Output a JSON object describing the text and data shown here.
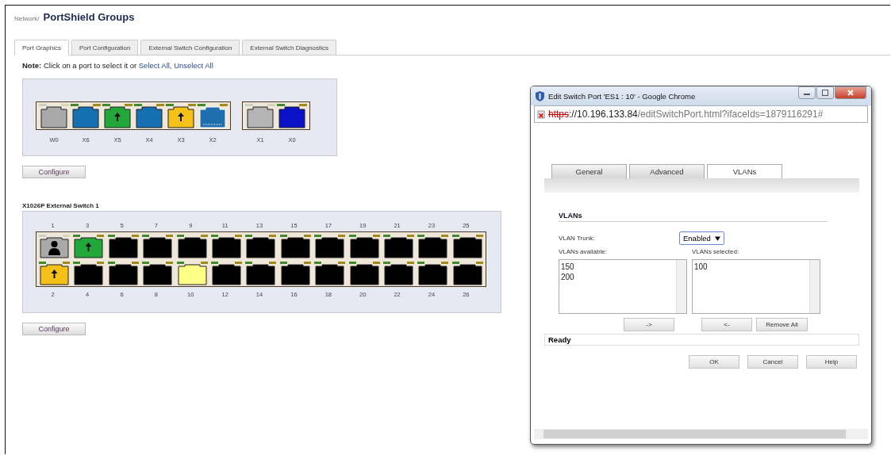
{
  "breadcrumb": {
    "parent": "Network",
    "separator": "/",
    "title": "PortShield Groups"
  },
  "tabs": [
    {
      "label": "Port Graphics",
      "selected": true
    },
    {
      "label": "Port Configuration",
      "selected": false
    },
    {
      "label": "External Switch Configuration",
      "selected": false
    },
    {
      "label": "External Switch Diagnostics",
      "selected": false
    }
  ],
  "note": {
    "text": "**Note:** Click on a port to select it or",
    "links": [
      "Select All",
      "Unselect All"
    ],
    "separator": ","
  },
  "builtin_switch": {
    "groups": [
      {
        "ports": [
          {
            "label": "W0",
            "color": "#a9a9a9",
            "kind": "plain"
          },
          {
            "label": "X6",
            "color": "#1470b0",
            "kind": "plain"
          },
          {
            "label": "X5",
            "color": "#22a83a",
            "kind": "arrow"
          },
          {
            "label": "X4",
            "color": "#1470b0",
            "kind": "plain"
          },
          {
            "label": "X3",
            "color": "#f5c018",
            "kind": "arrow"
          },
          {
            "label": "X2",
            "color": "#1f6fae",
            "kind": "outline"
          }
        ]
      },
      {
        "ports": [
          {
            "label": "X1",
            "color": "#b4b4b4",
            "kind": "plain"
          },
          {
            "label": "X0",
            "color": "#0a12c8",
            "kind": "plain"
          }
        ]
      }
    ],
    "button": "Configure"
  },
  "external_switch": {
    "title": "X1026P External Switch 1",
    "top_row": [
      {
        "label": "1",
        "color": "#a9a9a9",
        "kind": "person"
      },
      {
        "label": "3",
        "color": "#22a83a",
        "kind": "arrow"
      },
      {
        "label": "5",
        "color": "#000000",
        "kind": "plain"
      },
      {
        "label": "7",
        "color": "#000000",
        "kind": "plain"
      },
      {
        "label": "9",
        "color": "#000000",
        "kind": "plain"
      },
      {
        "label": "11",
        "color": "#000000",
        "kind": "plain"
      },
      {
        "label": "13",
        "color": "#000000",
        "kind": "plain"
      },
      {
        "label": "15",
        "color": "#000000",
        "kind": "plain"
      },
      {
        "label": "17",
        "color": "#000000",
        "kind": "plain"
      },
      {
        "label": "19",
        "color": "#000000",
        "kind": "plain"
      },
      {
        "label": "21",
        "color": "#000000",
        "kind": "plain"
      },
      {
        "label": "23",
        "color": "#000000",
        "kind": "plain"
      },
      {
        "label": "25",
        "color": "#000000",
        "kind": "plain"
      }
    ],
    "bottom_row": [
      {
        "label": "2",
        "color": "#f5c018",
        "kind": "arrow"
      },
      {
        "label": "4",
        "color": "#000000",
        "kind": "plain"
      },
      {
        "label": "6",
        "color": "#000000",
        "kind": "plain"
      },
      {
        "label": "8",
        "color": "#000000",
        "kind": "plain"
      },
      {
        "label": "10",
        "color": "#ffff88",
        "kind": "plain"
      },
      {
        "label": "12",
        "color": "#000000",
        "kind": "plain"
      },
      {
        "label": "14",
        "color": "#000000",
        "kind": "plain"
      },
      {
        "label": "16",
        "color": "#000000",
        "kind": "plain"
      },
      {
        "label": "18",
        "color": "#000000",
        "kind": "plain"
      },
      {
        "label": "20",
        "color": "#000000",
        "kind": "plain"
      },
      {
        "label": "22",
        "color": "#000000",
        "kind": "plain"
      },
      {
        "label": "24",
        "color": "#000000",
        "kind": "plain"
      },
      {
        "label": "26",
        "color": "#000000",
        "kind": "plain"
      }
    ],
    "button": "Configure"
  },
  "popup": {
    "title": "Edit Switch Port 'ES1 : 10' - Google Chrome",
    "address": {
      "scheme": "https",
      "host": "://10.196.133.84",
      "path": "/editSwitchPort.html?ifaceIds=1879116291#"
    },
    "tabs": [
      {
        "label": "General",
        "selected": false
      },
      {
        "label": "Advanced",
        "selected": false
      },
      {
        "label": "VLANs",
        "selected": true
      }
    ],
    "section": "VLANs",
    "trunk": {
      "label": "VLAN Trunk:",
      "value": "Enabled"
    },
    "available": {
      "label": "VLANs available:",
      "items": [
        "150",
        "200"
      ]
    },
    "selected_list": {
      "label": "VLANs selected:",
      "items": [
        "100"
      ]
    },
    "move_buttons": [
      "->",
      "<-",
      "Remove All"
    ],
    "status": "Ready",
    "buttons": [
      "OK",
      "Cancel",
      "Help"
    ]
  }
}
